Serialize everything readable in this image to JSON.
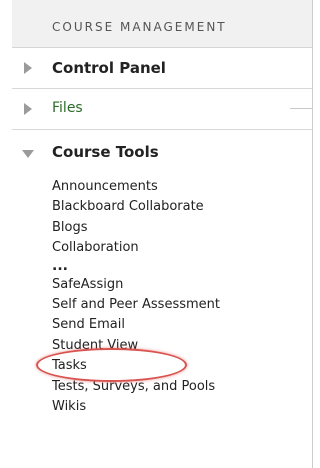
{
  "header": {
    "title": "COURSE MANAGEMENT"
  },
  "control_panel": {
    "label": "Control Panel"
  },
  "files": {
    "label": "Files"
  },
  "course_tools": {
    "label": "Course Tools",
    "items": [
      "Announcements",
      "Blackboard Collaborate",
      "Blogs",
      "Collaboration",
      "...",
      "SafeAssign",
      "Self and Peer Assessment",
      "Send Email",
      "Student View",
      "Tasks",
      "Tests, Surveys, and Pools",
      "Wikis"
    ]
  },
  "colors": {
    "highlight": "#d9534f",
    "files_link": "#2b6b2b"
  },
  "icons": {
    "collapsed": "triangle-right-icon",
    "expanded": "triangle-down-icon"
  }
}
